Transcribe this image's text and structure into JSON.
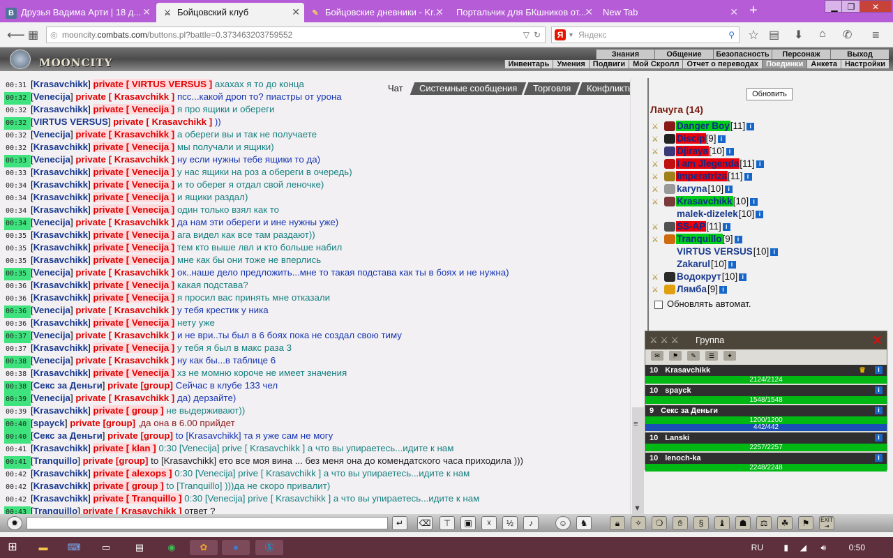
{
  "browser": {
    "tabs": [
      {
        "title": "Друзья Вадима Арти | 18 д...",
        "fav": "В",
        "fav_color": "#507299"
      },
      {
        "title": "Бойцовский клуб",
        "fav": "⚔",
        "fav_color": "#888888"
      },
      {
        "title": "Бойцовские дневники - Kr...",
        "fav": "✎",
        "fav_color": "#d4a020"
      },
      {
        "title": "Портальчик для БКшников от...",
        "fav": "",
        "fav_color": ""
      },
      {
        "title": "New Tab",
        "fav": "",
        "fav_color": ""
      }
    ],
    "url_host": "mooncity.",
    "url_domain": "combats.com",
    "url_path": "/buttons.pl?battle=0.373463203759552",
    "search_placeholder": "Яндекс",
    "yandex_letter": "Я"
  },
  "game": {
    "logo": "MOONCITY",
    "top_menu": [
      "Знания",
      "Общение",
      "Безопасность",
      "Персонаж",
      "Выход"
    ],
    "sub_menu": [
      "Инвентарь",
      "Умения",
      "Подвиги",
      "Мой Скролл",
      "Отчет о переводах",
      "Поединки",
      "Анкета",
      "Настройки"
    ],
    "sub_menu_selected": "Поединки"
  },
  "chat_tabs": [
    "Чат",
    "Системные сообщения",
    "Торговля",
    "Конфликты"
  ],
  "chat": [
    {
      "t": "00:31",
      "hl": false,
      "from": "Krasavchikk",
      "pv": "private [ VIRTUS VERSUS ]",
      "msg": "ахахах я то до конца",
      "c": "t"
    },
    {
      "t": "00:32",
      "hl": true,
      "from": "Venecija",
      "pv": "private [ Krasavchikk ]",
      "msg": "псс...какой дроп то? пиастры от урона",
      "c": "b"
    },
    {
      "t": "00:32",
      "hl": false,
      "from": "Krasavchikk",
      "pv": "private [ Venecija ]",
      "msg": "я про ящики и обереги",
      "c": "t"
    },
    {
      "t": "00:32",
      "hl": true,
      "from": "VIRTUS VERSUS",
      "pv": "private [ Krasavchikk ]",
      "msg": "))",
      "c": "b"
    },
    {
      "t": "00:32",
      "hl": false,
      "from": "Venecija",
      "pv": "private [ Krasavchikk ]",
      "msg": "а обереги вы и так не получаете",
      "c": "t"
    },
    {
      "t": "00:32",
      "hl": false,
      "from": "Krasavchikk",
      "pv": "private [ Venecija ]",
      "msg": "мы получали и ящики)",
      "c": "t"
    },
    {
      "t": "00:33",
      "hl": true,
      "from": "Venecija",
      "pv": "private [ Krasavchikk ]",
      "msg": "ну если нужны тебе ящики то да)",
      "c": "b"
    },
    {
      "t": "00:33",
      "hl": false,
      "from": "Krasavchikk",
      "pv": "private [ Venecija ]",
      "msg": "у нас ящики на роз а обереги в очередь)",
      "c": "t"
    },
    {
      "t": "00:34",
      "hl": false,
      "from": "Krasavchikk",
      "pv": "private [ Venecija ]",
      "msg": "и то оберег я отдал свой леночке)",
      "c": "t"
    },
    {
      "t": "00:34",
      "hl": false,
      "from": "Krasavchikk",
      "pv": "private [ Venecija ]",
      "msg": "и ящики раздал)",
      "c": "t"
    },
    {
      "t": "00:34",
      "hl": false,
      "from": "Krasavchikk",
      "pv": "private [ Venecija ]",
      "msg": "один только взял как то",
      "c": "t"
    },
    {
      "t": "00:34",
      "hl": true,
      "from": "Venecija",
      "pv": "private [ Krasavchikk ]",
      "msg": "да нам эти обереги и ине нужны уже)",
      "c": "b"
    },
    {
      "t": "00:35",
      "hl": false,
      "from": "Krasavchikk",
      "pv": "private [ Venecija ]",
      "msg": "ага видел как все там раздают))",
      "c": "t"
    },
    {
      "t": "00:35",
      "hl": false,
      "from": "Krasavchikk",
      "pv": "private [ Venecija ]",
      "msg": "тем кто выше лвл и кто больше набил",
      "c": "t"
    },
    {
      "t": "00:35",
      "hl": false,
      "from": "Krasavchikk",
      "pv": "private [ Venecija ]",
      "msg": "мне как бы они тоже не вперлись",
      "c": "t"
    },
    {
      "t": "00:35",
      "hl": true,
      "from": "Venecija",
      "pv": "private [ Krasavchikk ]",
      "msg": "ок..наше дело предложить...мне то такая подстава как ты в боях и не нужна)",
      "c": "b"
    },
    {
      "t": "00:36",
      "hl": false,
      "from": "Krasavchikk",
      "pv": "private [ Venecija ]",
      "msg": "какая подстава?",
      "c": "t"
    },
    {
      "t": "00:36",
      "hl": false,
      "from": "Krasavchikk",
      "pv": "private [ Venecija ]",
      "msg": "я просил вас принять мне отказали",
      "c": "t"
    },
    {
      "t": "00:36",
      "hl": true,
      "from": "Venecija",
      "pv": "private [ Krasavchikk ]",
      "msg": "у тебя крестик у ника",
      "c": "b"
    },
    {
      "t": "00:36",
      "hl": false,
      "from": "Krasavchikk",
      "pv": "private [ Venecija ]",
      "msg": "нету уже",
      "c": "t"
    },
    {
      "t": "00:37",
      "hl": true,
      "from": "Venecija",
      "pv": "private [ Krasavchikk ]",
      "msg": "и не ври..ты был в 6 боях пока не создал свою тиму",
      "c": "b"
    },
    {
      "t": "00:37",
      "hl": false,
      "from": "Krasavchikk",
      "pv": "private [ Venecija ]",
      "msg": "у тебя я был в макс раза 3",
      "c": "t"
    },
    {
      "t": "00:38",
      "hl": true,
      "from": "Venecija",
      "pv": "private [ Krasavchikk ]",
      "msg": "ну как бы...в таблице 6",
      "c": "b"
    },
    {
      "t": "00:38",
      "hl": false,
      "from": "Krasavchikk",
      "pv": "private [ Venecija ]",
      "msg": "хз не момню короче не имеет значения",
      "c": "t"
    },
    {
      "t": "00:38",
      "hl": true,
      "from": "Секс за Деньги",
      "pv": "private [group]",
      "msg": "Сейчас в клубе 133 чел",
      "c": "b"
    },
    {
      "t": "00:39",
      "hl": true,
      "from": "Venecija",
      "pv": "private [ Krasavchikk ]",
      "msg": "да) дерзайте)",
      "c": "b"
    },
    {
      "t": "00:39",
      "hl": false,
      "from": "Krasavchikk",
      "pv": "private [ group ]",
      "msg": "не выдерживают))",
      "c": "t"
    },
    {
      "t": "00:40",
      "hl": true,
      "from": "spayck",
      "pv": "private [group]",
      "msg": ",да она в 6.00 прийдет",
      "c": "r"
    },
    {
      "t": "00:40",
      "hl": true,
      "from": "Секс за Деньги",
      "pv": "private [group]",
      "msg": "to [Krasavchikk] та я уже сам не могу",
      "c": "b"
    },
    {
      "t": "00:41",
      "hl": false,
      "from": "Krasavchikk",
      "pv": "private [ klan ]",
      "msg": "0:30 [Venecija] prive [ Krasavchikk ] а что вы упираетесь...идите к нам",
      "c": "t"
    },
    {
      "t": "00:41",
      "hl": true,
      "from": "Tranquillo",
      "pv": "private [group]",
      "msg": "to [Krasavchikk] ето все моя вина ... без меня она до комендатского часа приходила )))",
      "c": "d"
    },
    {
      "t": "00:42",
      "hl": false,
      "from": "Krasavchikk",
      "pv": "private [ alexops ]",
      "msg": "0:30 [Venecija] prive [ Krasavchikk ] а что вы упираетесь...идите к нам",
      "c": "t"
    },
    {
      "t": "00:42",
      "hl": false,
      "from": "Krasavchikk",
      "pv": "private [ group ]",
      "msg": "to [Tranquillo] )))да не скоро привалит)",
      "c": "t"
    },
    {
      "t": "00:42",
      "hl": false,
      "from": "Krasavchikk",
      "pv": "private [ Tranquillo ]",
      "msg": "0:30 [Venecija] prive [ Krasavchikk ] а что вы упираетесь...идите к нам",
      "c": "t"
    },
    {
      "t": "00:43",
      "hl": true,
      "from": "Tranquillo",
      "pv": "private [ Krasavchikk ]",
      "msg": "ответ ?",
      "c": "d"
    }
  ],
  "panel": {
    "refresh": "Обновить",
    "location": "Лачуга (14)",
    "auto_refresh": "Обновлять автомат.",
    "players": [
      {
        "name": "Danger Boy",
        "lvl": "[11]",
        "hl": "g",
        "av": "#8a1a1a"
      },
      {
        "name": "Discip",
        "lvl": "[9]",
        "hl": "r",
        "av": "#222222"
      },
      {
        "name": "Djiraya",
        "lvl": "[10]",
        "hl": "r",
        "av": "#3a3a7a"
      },
      {
        "name": "I am Jlegenda",
        "lvl": "[11]",
        "hl": "r",
        "av": "#c01010"
      },
      {
        "name": "Imperatriza",
        "lvl": "[11]",
        "hl": "r",
        "av": "#a0801a"
      },
      {
        "name": "karyna",
        "lvl": "[10]",
        "hl": "",
        "av": "#9a9a9a"
      },
      {
        "name": "Krasavchikk",
        "lvl": "[10]",
        "hl": "g",
        "av": "#7a3a3a"
      },
      {
        "name": "malek-dizelek",
        "lvl": "[10]",
        "hl": "",
        "av": ""
      },
      {
        "name": "SS-AP",
        "lvl": "[11]",
        "hl": "r",
        "av": "#505050"
      },
      {
        "name": "Tranquillo",
        "lvl": "[9]",
        "hl": "g",
        "av": "#d06a10"
      },
      {
        "name": "VIRTUS VERSUS",
        "lvl": "[10]",
        "hl": "",
        "av": ""
      },
      {
        "name": "Zakarul",
        "lvl": "[10]",
        "hl": "",
        "av": ""
      },
      {
        "name": "Водокрут",
        "lvl": "[10]",
        "hl": "",
        "av": "#2a2a2a"
      },
      {
        "name": "Лямба",
        "lvl": "[9]",
        "hl": "",
        "av": "#e0a010"
      }
    ]
  },
  "group": {
    "title": "Группа",
    "members": [
      {
        "lvl": "10",
        "name": "Krasavchikk",
        "hp": "2124/2124",
        "mp": "",
        "leader": true
      },
      {
        "lvl": "10",
        "name": "spayck",
        "hp": "1548/1548",
        "mp": "",
        "leader": false
      },
      {
        "lvl": "9",
        "name": "Секс за Деньги",
        "hp": "1200/1200",
        "mp": "442/442",
        "leader": false
      },
      {
        "lvl": "10",
        "name": "Lanski",
        "hp": "2257/2257",
        "mp": "",
        "leader": false
      },
      {
        "lvl": "10",
        "name": "lenoch-ka",
        "hp": "2248/2248",
        "mp": "",
        "leader": false
      }
    ]
  },
  "bottom_exit": "EXIT",
  "taskbar": {
    "lang": "RU",
    "time": "0:50"
  }
}
